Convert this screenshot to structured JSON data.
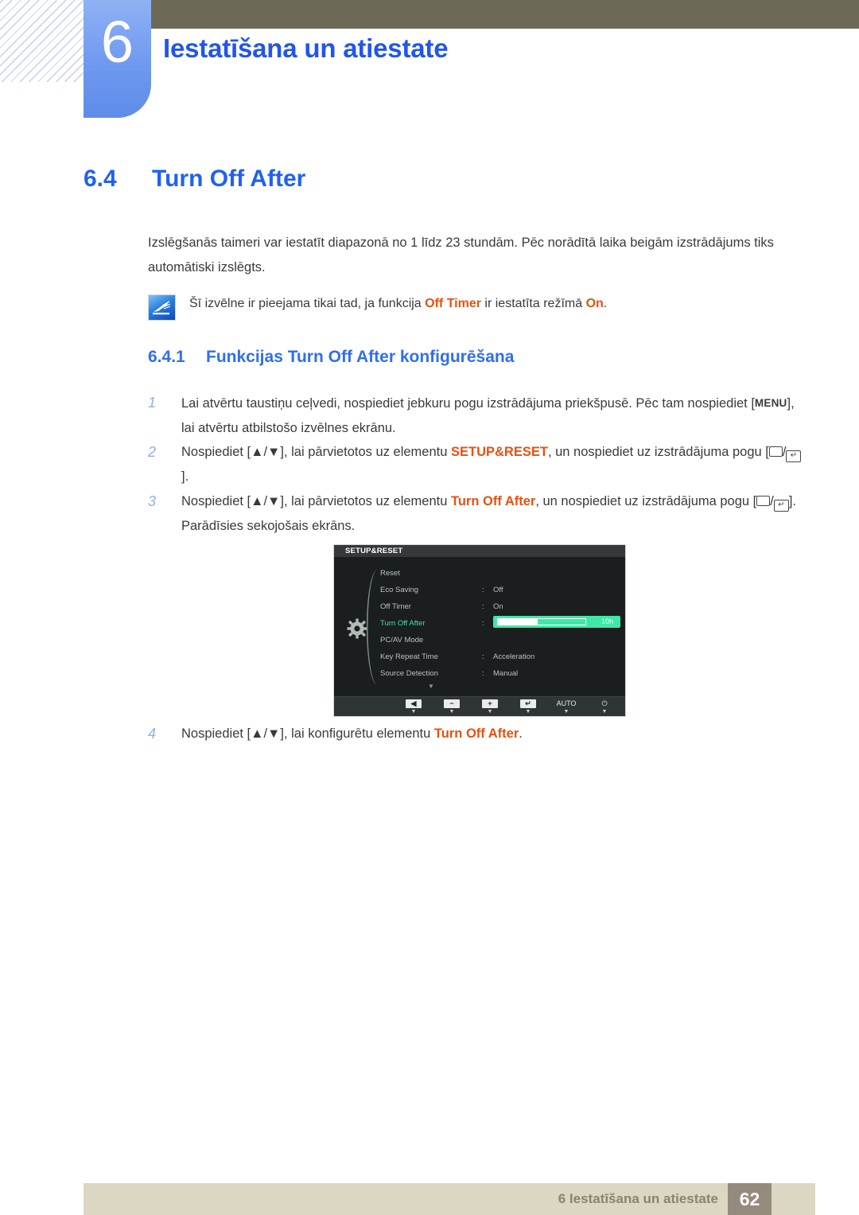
{
  "header": {
    "chapter_number": "6",
    "chapter_title": "Iestatīšana un atiestate"
  },
  "section": {
    "number": "6.4",
    "title": "Turn Off After"
  },
  "intro_paragraph": "Izslēgšanās taimeri var iestatīt diapazonā no 1 līdz 23 stundām. Pēc norādītā laika beigām izstrādājums tiks automātiski izslēgts.",
  "note": {
    "icon": "note-pencil-icon",
    "text_before": "Šī izvēlne ir pieejama tikai tad, ja funkcija ",
    "keyword1": "Off Timer",
    "text_middle": " ir iestatīta režīmā ",
    "keyword2": "On",
    "text_after": "."
  },
  "subsection": {
    "number": "6.4.1",
    "title": "Funkcijas Turn Off After konfigurēšana"
  },
  "steps": [
    {
      "number": "1",
      "part1": "Lai atvērtu taustiņu ceļvedi, nospiediet jebkuru pogu izstrādājuma priekšpusē. Pēc tam nospiediet [",
      "key": "MENU",
      "part2": "], lai atvērtu atbilstošo izvēlnes ekrānu."
    },
    {
      "number": "2",
      "part1": "Nospiediet [▲/▼], lai pārvietotos uz elementu ",
      "keyword": "SETUP&RESET",
      "part2": ", un nospiediet uz izstrādājuma pogu [",
      "part3": "/",
      "part4": "]."
    },
    {
      "number": "3",
      "part1": "Nospiediet [▲/▼], lai pārvietotos uz elementu ",
      "keyword": "Turn Off After",
      "part2": ", un nospiediet uz izstrādājuma pogu [",
      "part3": "/",
      "part4": "]. Parādīsies sekojošais ekrāns."
    },
    {
      "number": "4",
      "part1": "Nospiediet [▲/▼], lai konfigurētu elementu ",
      "keyword": "Turn Off After",
      "part2": "."
    }
  ],
  "osd": {
    "title": "SETUP&RESET",
    "rows": [
      {
        "label": "Reset",
        "colon": "",
        "value": "",
        "active": false
      },
      {
        "label": "Eco Saving",
        "colon": ":",
        "value": "Off",
        "active": false
      },
      {
        "label": "Off Timer",
        "colon": ":",
        "value": "On",
        "active": false
      },
      {
        "label": "Turn Off After",
        "colon": ":",
        "value": "10h",
        "active": true
      },
      {
        "label": "PC/AV Mode",
        "colon": "",
        "value": "",
        "active": false
      },
      {
        "label": "Key Repeat Time",
        "colon": ":",
        "value": "Acceleration",
        "active": false
      },
      {
        "label": "Source Detection",
        "colon": ":",
        "value": "Manual",
        "active": false
      }
    ],
    "slider_value": "10h",
    "slider_fill_percent": 45,
    "submenu_arrow": "▶",
    "scroll_down_arrow": "▼",
    "buttons": [
      {
        "glyph": "◀",
        "name": "back-button",
        "type": "cap"
      },
      {
        "glyph": "−",
        "name": "minus-button",
        "type": "cap"
      },
      {
        "glyph": "+",
        "name": "plus-button",
        "type": "cap"
      },
      {
        "glyph": "↵",
        "name": "enter-button",
        "type": "cap"
      },
      {
        "glyph": "AUTO",
        "name": "auto-button",
        "type": "txt"
      },
      {
        "glyph": "⏻",
        "name": "power-button",
        "type": "txt"
      }
    ],
    "button_marker": "▼",
    "accent_green": "#3fe8a8",
    "bg_color": "#1b1e1f"
  },
  "footer": {
    "text": "6 Iestatīšana un atiestate",
    "page": "62"
  }
}
